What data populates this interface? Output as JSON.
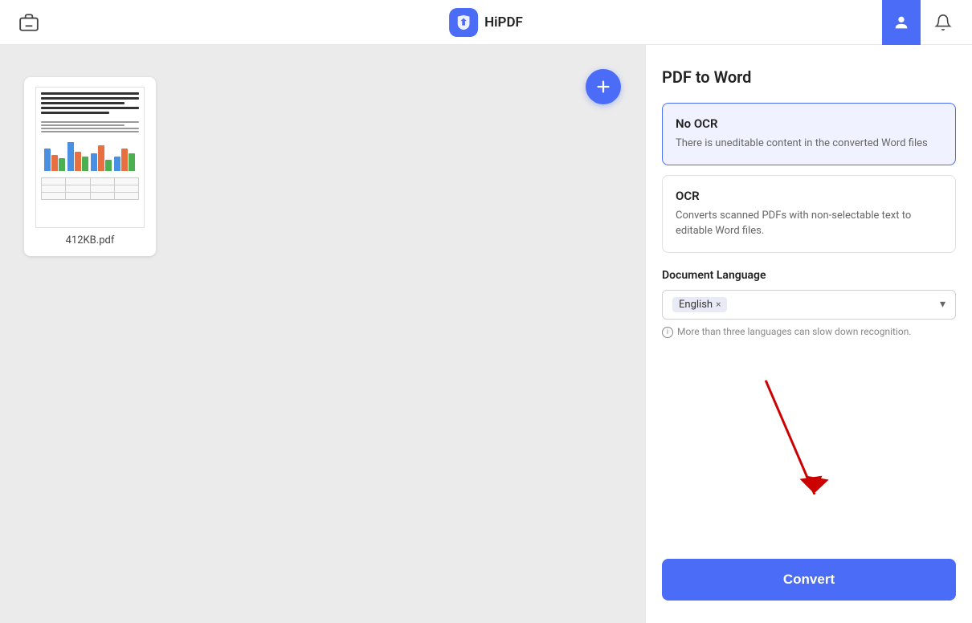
{
  "header": {
    "toolbox_label": "toolbox",
    "app_name": "HiPDF",
    "notification_label": "notifications"
  },
  "file": {
    "name": "412KB.pdf",
    "add_button_label": "+"
  },
  "panel": {
    "title": "PDF to Word",
    "no_ocr": {
      "label": "No OCR",
      "description": "There is uneditable content in the converted Word files"
    },
    "ocr": {
      "label": "OCR",
      "description": "Converts scanned PDFs with non-selectable text to editable Word files."
    },
    "document_language_label": "Document Language",
    "language_tag": "English",
    "language_hint": "More than three languages can slow down recognition.",
    "convert_button": "Convert"
  },
  "colors": {
    "accent": "#4A6CF7",
    "selected_bg": "#f0f2ff"
  }
}
